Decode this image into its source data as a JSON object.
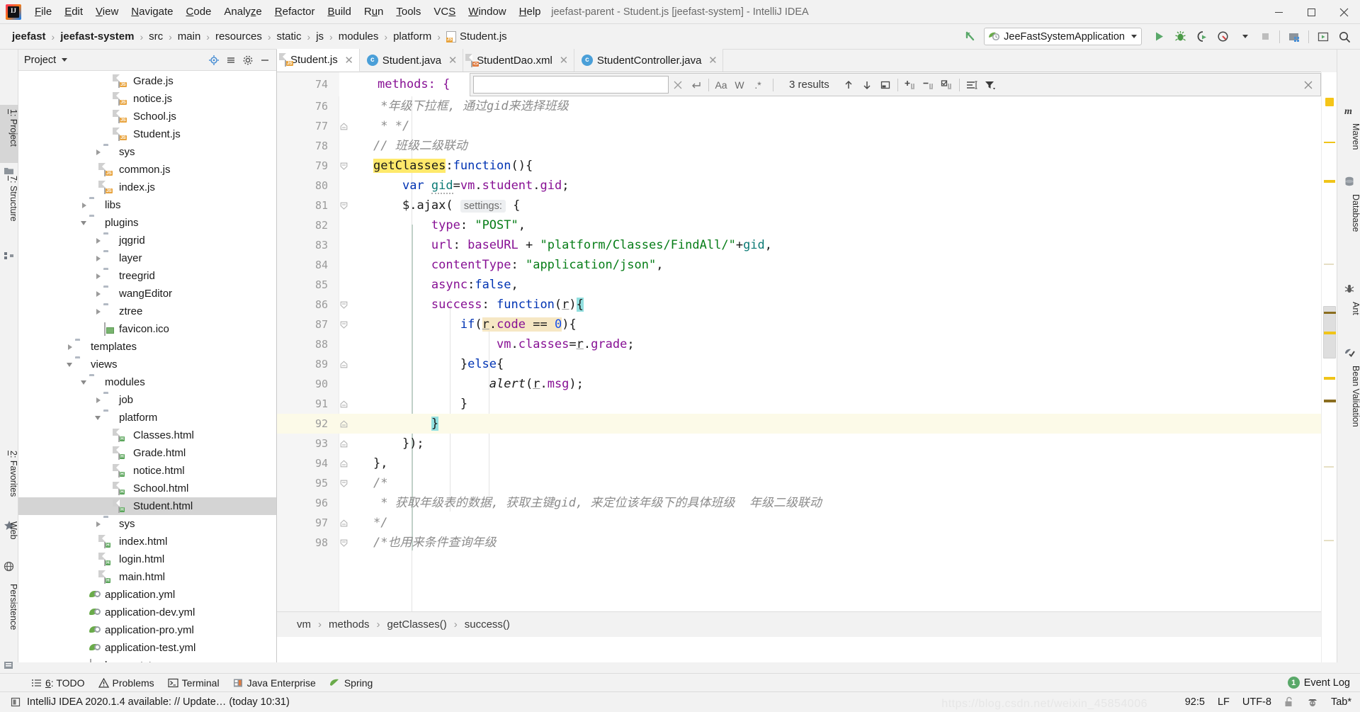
{
  "window": {
    "title": "jeefast-parent - Student.js [jeefast-system] - IntelliJ IDEA",
    "minimize": "─",
    "maximize": "❐",
    "close": "✕"
  },
  "menubar": {
    "items": [
      {
        "label": "File",
        "accel": "F"
      },
      {
        "label": "Edit",
        "accel": "E"
      },
      {
        "label": "View",
        "accel": "V"
      },
      {
        "label": "Navigate",
        "accel": "N"
      },
      {
        "label": "Code",
        "accel": "C"
      },
      {
        "label": "Analyze",
        "accel": "z"
      },
      {
        "label": "Refactor",
        "accel": "R"
      },
      {
        "label": "Build",
        "accel": "B"
      },
      {
        "label": "Run",
        "accel": "u"
      },
      {
        "label": "Tools",
        "accel": "T"
      },
      {
        "label": "VCS",
        "accel": "S"
      },
      {
        "label": "Window",
        "accel": "W"
      },
      {
        "label": "Help",
        "accel": "H"
      }
    ]
  },
  "breadcrumb": {
    "items": [
      "jeefast",
      "jeefast-system",
      "src",
      "main",
      "resources",
      "static",
      "js",
      "modules",
      "platform",
      "Student.js"
    ],
    "separator": "›"
  },
  "toolbar": {
    "run_config": "JeeFastSystemApplication",
    "icons": [
      "back-arrow-icon",
      "run-icon",
      "debug-icon",
      "run-with-coverage-icon",
      "profile-icon",
      "stop-icon",
      "project-structure-icon",
      "open-preview-icon",
      "search-everywhere-icon"
    ]
  },
  "left_tool_strip": {
    "tabs": [
      {
        "label": "1: Project",
        "accel": "1",
        "active": true,
        "icon": "project-folder-icon"
      },
      {
        "label": "7: Structure",
        "accel": "7",
        "active": false,
        "icon": "structure-icon"
      },
      {
        "label": "2: Favorites",
        "accel": "2",
        "active": false,
        "icon": "star-icon"
      },
      {
        "label": "Web",
        "accel": "",
        "active": false,
        "icon": "web-globe-icon"
      },
      {
        "label": "Persistence",
        "accel": "",
        "active": false,
        "icon": "persistence-icon"
      }
    ]
  },
  "right_tool_strip": {
    "tabs": [
      {
        "label": "Maven",
        "icon": "maven-m-icon"
      },
      {
        "label": "Database",
        "icon": "database-icon"
      },
      {
        "label": "Ant",
        "icon": "ant-icon"
      },
      {
        "label": "Bean Validation",
        "icon": "bean-validation-icon"
      }
    ]
  },
  "project_panel": {
    "title": "Project",
    "header_icons": [
      "locate-icon",
      "collapse-all-icon",
      "settings-gear-icon",
      "hide-icon"
    ],
    "tree": [
      {
        "indent": 6,
        "arrow": "none",
        "icon": "js-file-icon",
        "label": "Grade.js"
      },
      {
        "indent": 6,
        "arrow": "none",
        "icon": "js-file-icon",
        "label": "notice.js"
      },
      {
        "indent": 6,
        "arrow": "none",
        "icon": "js-file-icon",
        "label": "School.js"
      },
      {
        "indent": 6,
        "arrow": "none",
        "icon": "js-file-icon",
        "label": "Student.js"
      },
      {
        "indent": 5,
        "arrow": "right",
        "icon": "folder-icon",
        "label": "sys"
      },
      {
        "indent": 5,
        "arrow": "none",
        "icon": "js-file-icon",
        "label": "common.js"
      },
      {
        "indent": 5,
        "arrow": "none",
        "icon": "js-file-icon",
        "label": "index.js"
      },
      {
        "indent": 4,
        "arrow": "right",
        "icon": "folder-icon",
        "label": "libs"
      },
      {
        "indent": 4,
        "arrow": "down",
        "icon": "folder-icon",
        "label": "plugins"
      },
      {
        "indent": 5,
        "arrow": "right",
        "icon": "folder-icon",
        "label": "jqgrid"
      },
      {
        "indent": 5,
        "arrow": "right",
        "icon": "folder-icon",
        "label": "layer"
      },
      {
        "indent": 5,
        "arrow": "right",
        "icon": "folder-icon",
        "label": "treegrid"
      },
      {
        "indent": 5,
        "arrow": "right",
        "icon": "folder-icon",
        "label": "wangEditor"
      },
      {
        "indent": 5,
        "arrow": "right",
        "icon": "folder-icon",
        "label": "ztree"
      },
      {
        "indent": 5,
        "arrow": "none",
        "icon": "ico-file-icon",
        "label": "favicon.ico"
      },
      {
        "indent": 3,
        "arrow": "right",
        "icon": "folder-icon",
        "label": "templates"
      },
      {
        "indent": 3,
        "arrow": "down",
        "icon": "folder-icon",
        "label": "views"
      },
      {
        "indent": 4,
        "arrow": "down",
        "icon": "folder-icon",
        "label": "modules"
      },
      {
        "indent": 5,
        "arrow": "right",
        "icon": "folder-icon",
        "label": "job"
      },
      {
        "indent": 5,
        "arrow": "down",
        "icon": "folder-icon",
        "label": "platform"
      },
      {
        "indent": 6,
        "arrow": "none",
        "icon": "html-file-icon",
        "label": "Classes.html"
      },
      {
        "indent": 6,
        "arrow": "none",
        "icon": "html-file-icon",
        "label": "Grade.html"
      },
      {
        "indent": 6,
        "arrow": "none",
        "icon": "html-file-icon",
        "label": "notice.html"
      },
      {
        "indent": 6,
        "arrow": "none",
        "icon": "html-file-icon",
        "label": "School.html"
      },
      {
        "indent": 6,
        "arrow": "none",
        "icon": "html-file-icon",
        "label": "Student.html",
        "selected": true
      },
      {
        "indent": 5,
        "arrow": "right",
        "icon": "folder-icon",
        "label": "sys"
      },
      {
        "indent": 5,
        "arrow": "none",
        "icon": "html-file-icon",
        "label": "index.html"
      },
      {
        "indent": 5,
        "arrow": "none",
        "icon": "html-file-icon",
        "label": "login.html"
      },
      {
        "indent": 5,
        "arrow": "none",
        "icon": "html-file-icon",
        "label": "main.html"
      },
      {
        "indent": 4,
        "arrow": "none",
        "icon": "yml-file-icon",
        "label": "application.yml"
      },
      {
        "indent": 4,
        "arrow": "none",
        "icon": "yml-file-icon",
        "label": "application-dev.yml"
      },
      {
        "indent": 4,
        "arrow": "none",
        "icon": "yml-file-icon",
        "label": "application-pro.yml"
      },
      {
        "indent": 4,
        "arrow": "none",
        "icon": "yml-file-icon",
        "label": "application-test.yml"
      },
      {
        "indent": 4,
        "arrow": "none",
        "icon": "txt-file-icon",
        "label": "banner.txt"
      }
    ]
  },
  "editor": {
    "tabs": [
      {
        "label": "Student.js",
        "icon": "js-file-icon",
        "active": true
      },
      {
        "label": "Student.java",
        "icon": "java-class-icon",
        "active": false
      },
      {
        "label": "StudentDao.xml",
        "icon": "xml-file-icon",
        "active": false
      },
      {
        "label": "StudentController.java",
        "icon": "java-class-icon",
        "active": false
      }
    ],
    "sticky_line": {
      "number": "74",
      "text": "methods: {"
    },
    "find": {
      "value": "",
      "placeholder": "",
      "results": "3 results",
      "icons": [
        "close-icon",
        "newline-icon",
        "match-case-icon",
        "words-icon",
        "regex-icon",
        "prev-occurrence-icon",
        "next-occurrence-icon",
        "select-all-occurrences-icon",
        "add-selection-icon",
        "remove-selection-icon",
        "select-all-icon",
        "toggle-multiline-icon",
        "filter-icon"
      ]
    },
    "breadcrumbs_bottom": [
      "vm",
      "methods",
      "getClasses()",
      "success()"
    ],
    "caret_line": 92,
    "lines": [
      {
        "n": 76,
        "fold": "",
        "text": " *年级下拉框, 通过gid来选择班级"
      },
      {
        "n": 77,
        "fold": "minus",
        "text": " * */"
      },
      {
        "n": 78,
        "fold": "",
        "text": "// 班级二级联动"
      },
      {
        "n": 79,
        "fold": "collapse",
        "text": "getClasses:function(){"
      },
      {
        "n": 80,
        "fold": "",
        "text": "    var gid=vm.student.gid;"
      },
      {
        "n": 81,
        "fold": "collapse",
        "text": "    $.ajax( settings: {"
      },
      {
        "n": 82,
        "fold": "",
        "text": "        type: \"POST\","
      },
      {
        "n": 83,
        "fold": "",
        "text": "        url: baseURL + \"platform/Classes/FindAll/\"+gid,"
      },
      {
        "n": 84,
        "fold": "",
        "text": "        contentType: \"application/json\","
      },
      {
        "n": 85,
        "fold": "",
        "text": "        async:false,"
      },
      {
        "n": 86,
        "fold": "collapse",
        "text": "        success: function(r){"
      },
      {
        "n": 87,
        "fold": "collapse",
        "text": "            if(r.code == 0){"
      },
      {
        "n": 88,
        "fold": "",
        "text": "                 vm.classes=r.grade;"
      },
      {
        "n": 89,
        "fold": "minus",
        "text": "            }else{"
      },
      {
        "n": 90,
        "fold": "",
        "text": "                alert(r.msg);"
      },
      {
        "n": 91,
        "fold": "minus",
        "text": "            }"
      },
      {
        "n": 92,
        "fold": "minus",
        "text": "        }"
      },
      {
        "n": 93,
        "fold": "minus",
        "text": "    });"
      },
      {
        "n": 94,
        "fold": "minus",
        "text": "},"
      },
      {
        "n": 95,
        "fold": "collapse",
        "text": "/*"
      },
      {
        "n": 96,
        "fold": "",
        "text": " * 获取年级表的数据, 获取主键gid, 来定位该年级下的具体班级  年级二级联动"
      },
      {
        "n": 97,
        "fold": "minus",
        "text": "*/"
      },
      {
        "n": 98,
        "fold": "collapse",
        "text": "/*也用来条件查询年级"
      }
    ]
  },
  "bottom_toolbar": {
    "items": [
      {
        "label": "6: TODO",
        "accel": "6",
        "icon": "todo-list-icon"
      },
      {
        "label": "Problems",
        "accel": "",
        "icon": "problems-warning-icon"
      },
      {
        "label": "Terminal",
        "accel": "",
        "icon": "terminal-icon"
      },
      {
        "label": "Java Enterprise",
        "accel": "",
        "icon": "java-enterprise-icon"
      },
      {
        "label": "Spring",
        "accel": "",
        "icon": "spring-leaf-icon"
      }
    ]
  },
  "status_bar": {
    "message": "IntelliJ IDEA 2020.1.4 available: // Update… (today 10:31)",
    "message_icon": "notification-icon",
    "caret_position": "92:5",
    "line_separator": "LF",
    "encoding": "UTF-8",
    "lock_icon": "unlocked-padlock-icon",
    "inspection_icon": "inspector-hector-icon",
    "indent": "Tab*",
    "event_log": {
      "label": "Event Log",
      "count": "1"
    }
  },
  "watermark": "https://blog.csdn.net/weixin_45854006",
  "colors": {
    "accent_green": "#59a869",
    "search_highlight": "#ffe96b",
    "ident_highlight": "#f6e7c4",
    "brace_highlight": "#93e0e0",
    "caret_line": "#fcfae8",
    "selection": "#d4d4d4"
  }
}
